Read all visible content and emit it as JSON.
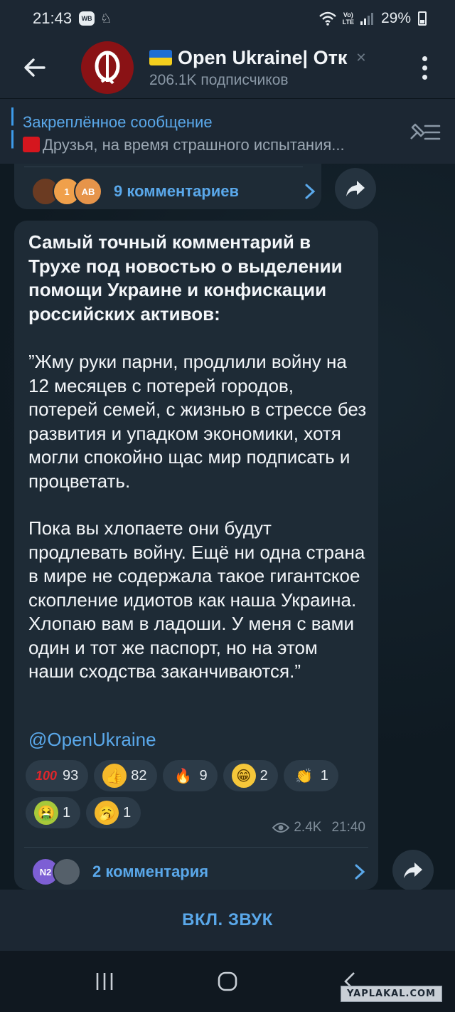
{
  "status_bar": {
    "time": "21:43",
    "badge": "WB",
    "lte_top": "Vo)",
    "lte_bottom": "LTE",
    "battery": "29%"
  },
  "header": {
    "title": "Open Ukraine| Отк",
    "subscribers": "206.1K подписчиков",
    "avatar_letter": "O"
  },
  "pinned": {
    "title": "Закреплённое сообщение",
    "text": "Друзья, на время страшного испытания..."
  },
  "prev_message": {
    "comments_label": "9 комментариев",
    "avatars": [
      "",
      "1",
      "AB"
    ]
  },
  "message": {
    "heading": "Самый точный комментарий в Трухе под новостью о выделении помощи Украине и конфискации российских активов:",
    "paragraph1": "”Жму руки парни, продлили войну на 12 месяцев с потерей городов, потерей семей, с жизнью в стрессе без развития и упадком экономики, хотя могли спокойно щас мир подписать и процветать.",
    "paragraph2": "Пока вы хлопаете они будут продлевать войну. Ещё ни одна страна в мире не содержала такое гигантское скопление идиотов как наша Украина. Хлопаю вам в ладоши. У меня с вами один и тот же паспорт, но на этом наши сходства заканчиваются.”",
    "link": "@OpenUkraine",
    "views": "2.4K",
    "time": "21:40",
    "comments_label": "2 комментария",
    "comment_avatars": [
      "N2",
      ""
    ],
    "reactions": [
      {
        "emoji": "100",
        "count": "93"
      },
      {
        "emoji": "👍",
        "count": "82"
      },
      {
        "emoji": "🔥",
        "count": "9"
      },
      {
        "emoji": "😁",
        "count": "2"
      },
      {
        "emoji": "👏",
        "count": "1"
      },
      {
        "emoji": "🤮",
        "count": "1"
      },
      {
        "emoji": "🥱",
        "count": "1"
      }
    ]
  },
  "bottom": {
    "unmute_label": "ВКЛ. ЗВУК"
  },
  "watermark": "YAPLAKAL.COM",
  "colors": {
    "accent": "#5aa8ea",
    "bubble": "#1e2b36",
    "header": "#1c2733",
    "channel_red": "#8a1215"
  }
}
